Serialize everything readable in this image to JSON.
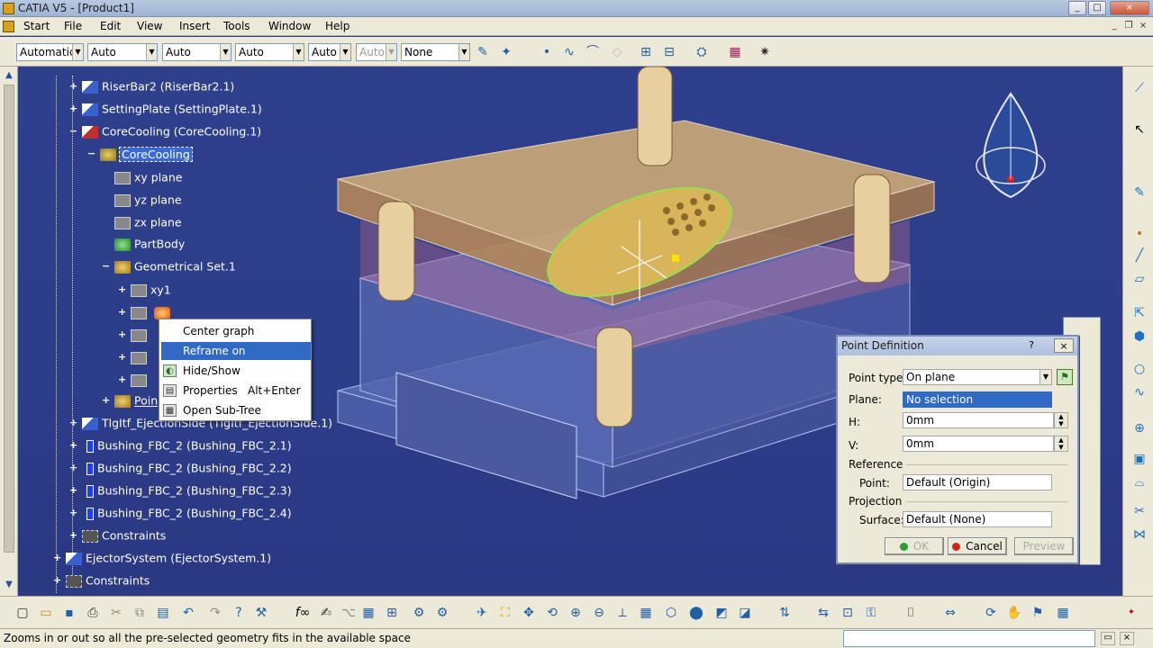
{
  "app": {
    "title": "CATIA V5 - [Product1]"
  },
  "menu": [
    "Start",
    "File",
    "Edit",
    "View",
    "Insert",
    "Tools",
    "Window",
    "Help"
  ],
  "propbar": {
    "combos": [
      "Automatic",
      "Auto",
      "Auto",
      "Auto",
      "Auto",
      "Auto",
      "None"
    ]
  },
  "tree": {
    "items": [
      {
        "label": "RiserBar2 (RiserBar2.1)"
      },
      {
        "label": "SettingPlate (SettingPlate.1)"
      },
      {
        "label": "CoreCooling (CoreCooling.1)"
      },
      {
        "label": "CoreCooling"
      },
      {
        "label": "xy plane"
      },
      {
        "label": "yz plane"
      },
      {
        "label": "zx plane"
      },
      {
        "label": "PartBody"
      },
      {
        "label": "Geometrical Set.1"
      },
      {
        "label": "xy1"
      },
      {
        "label": "Poin"
      },
      {
        "label": "TlgItf_EjectionSide (TlgItf_EjectionSide.1)"
      },
      {
        "label": "Bushing_FBC_2 (Bushing_FBC_2.1)"
      },
      {
        "label": "Bushing_FBC_2 (Bushing_FBC_2.2)"
      },
      {
        "label": "Bushing_FBC_2 (Bushing_FBC_2.3)"
      },
      {
        "label": "Bushing_FBC_2 (Bushing_FBC_2.4)"
      },
      {
        "label": "Constraints"
      },
      {
        "label": "EjectorSystem (EjectorSystem.1)"
      },
      {
        "label": "Constraints"
      }
    ]
  },
  "context_menu": {
    "items": [
      {
        "label": "Center graph",
        "shortcut": ""
      },
      {
        "label": "Reframe on",
        "shortcut": ""
      },
      {
        "label": "Hide/Show",
        "shortcut": ""
      },
      {
        "label": "Properties",
        "shortcut": "Alt+Enter"
      },
      {
        "label": "Open Sub-Tree",
        "shortcut": ""
      }
    ]
  },
  "dialog": {
    "title": "Point Definition",
    "help": "?",
    "close": "×",
    "point_type_label": "Point type:",
    "point_type_value": "On plane",
    "plane_label": "Plane:",
    "plane_value": "No selection",
    "h_label": "H:",
    "h_value": "0mm",
    "v_label": "V:",
    "v_value": "0mm",
    "reference_label": "Reference",
    "ref_point_label": "Point:",
    "ref_point_value": "Default (Origin)",
    "projection_label": "Projection",
    "surface_label": "Surface:",
    "surface_value": "Default (None)",
    "ok": "OK",
    "cancel": "Cancel",
    "preview": "Preview"
  },
  "status": {
    "message": "Zooms in or out so all the pre-selected geometry fits in the available space"
  },
  "colors": {
    "viewport": "#2c3d8a",
    "selection": "#316ac5"
  }
}
